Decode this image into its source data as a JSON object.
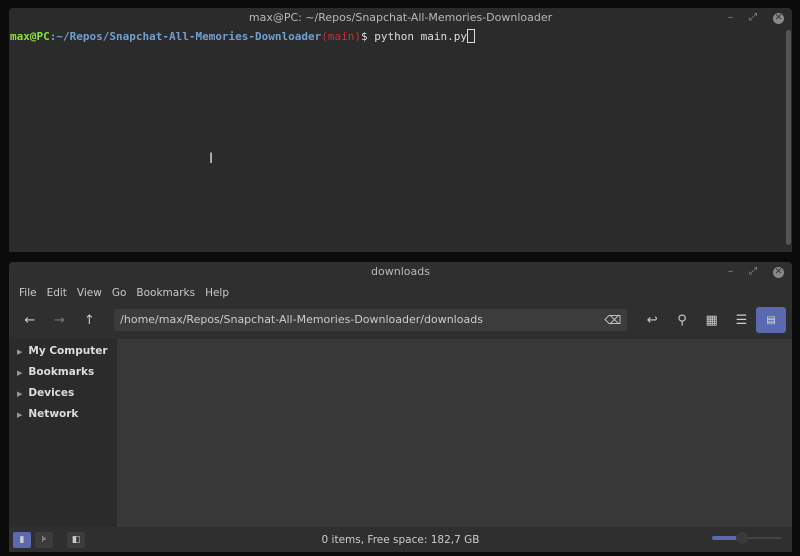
{
  "terminal": {
    "title": "max@PC: ~/Repos/Snapchat-All-Memories-Downloader",
    "user_host": "max@PC",
    "path": ":~/Repos/Snapchat-All-Memories-Downloader",
    "branch": "(main)",
    "prompt": "$ ",
    "command": "python main.py"
  },
  "filemanager": {
    "title": "downloads",
    "menu": [
      "File",
      "Edit",
      "View",
      "Go",
      "Bookmarks",
      "Help"
    ],
    "path": "/home/max/Repos/Snapchat-All-Memories-Downloader/downloads",
    "sidebar": [
      "My Computer",
      "Bookmarks",
      "Devices",
      "Network"
    ],
    "status": "0 items, Free space: 182,7 GB",
    "zoom_level": 0.4
  },
  "colors": {
    "accent": "#5b6ab0"
  }
}
